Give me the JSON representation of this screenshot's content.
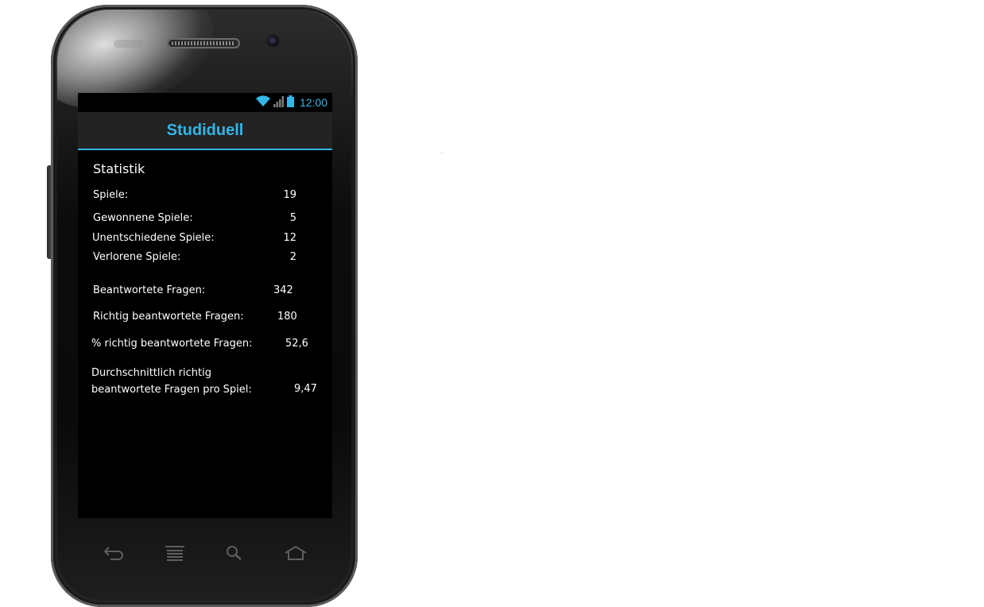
{
  "status_bar": {
    "time": "12:00",
    "icons": [
      "wifi-icon",
      "signal-icon",
      "battery-icon"
    ]
  },
  "app": {
    "title": "Studiduell",
    "accent_color": "#33b5e5"
  },
  "stats": {
    "heading": "Statistik",
    "games": {
      "label": "Spiele:",
      "value": "19"
    },
    "won": {
      "label": "Gewonnene Spiele:",
      "value": "5"
    },
    "draw": {
      "label": "Unentschiedene Spiele:",
      "value": "12"
    },
    "lost": {
      "label": "Verlorene Spiele:",
      "value": "2"
    },
    "answered": {
      "label": "Beantwortete Fragen:",
      "value": "342"
    },
    "correct": {
      "label": "Richtig beantwortete Fragen:",
      "value": "180"
    },
    "percent_correct": {
      "label": "% richtig beantwortete Fragen:",
      "value": "52,6"
    },
    "avg_correct": {
      "label_line1": "Durchschnittlich richtig",
      "label_line2": "beantwortete Fragen pro Spiel:",
      "value": "9,47"
    }
  },
  "nav_bar": {
    "buttons": [
      "back-icon",
      "menu-icon",
      "search-icon",
      "home-icon"
    ]
  }
}
